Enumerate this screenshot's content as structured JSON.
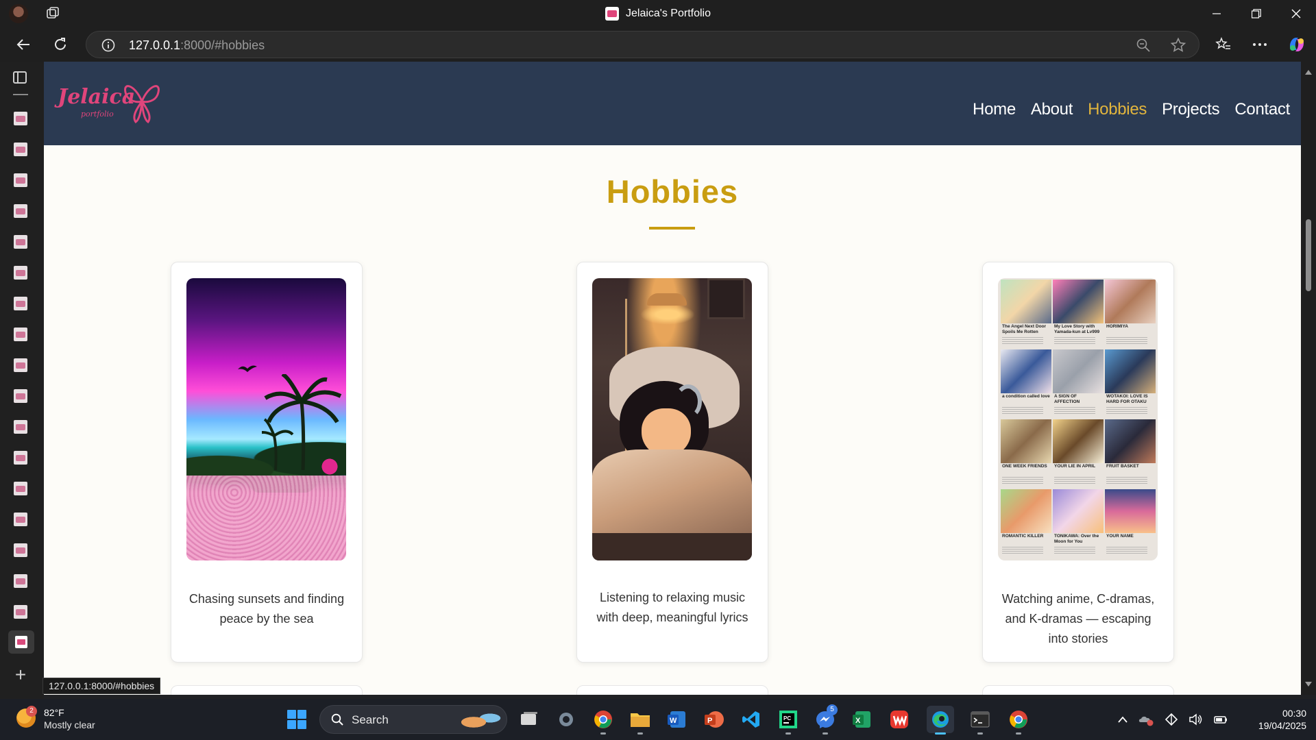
{
  "window": {
    "title": "Jelaica's Portfolio"
  },
  "address_bar": {
    "url_host": "127.0.0.1",
    "url_rest": ":8000/#hobbies"
  },
  "site": {
    "logo_text": "Jelaica",
    "logo_subtext": "portfolio",
    "nav": [
      "Home",
      "About",
      "Hobbies",
      "Projects",
      "Contact"
    ],
    "active_nav": "Hobbies",
    "section_title": "Hobbies",
    "hobbies": [
      {
        "image": "sunset-beach",
        "caption": "Chasing sunsets and finding peace by the sea"
      },
      {
        "image": "anime-girl-headphones",
        "caption": "Listening to relaxing music with deep, meaningful lyrics"
      },
      {
        "image": "anime-collage",
        "caption": "Watching anime, C-dramas, and K-dramas — escaping into stories"
      }
    ],
    "anime_titles": [
      "The Angel Next Door Spoils Me Rotten",
      "My Love Story with Yamada-kun at Lv999",
      "HORIMIYA",
      "a condition called love",
      "A SIGN OF AFFECTION",
      "WOTAKOI: LOVE IS HARD FOR OTAKU",
      "ONE WEEK FRIENDS",
      "YOUR LIE IN APRIL",
      "FRUIT BASKET",
      "ROMANTIC KILLER",
      "TONIKAWA: Over the Moon for You",
      "YOUR NAME"
    ]
  },
  "status_bar": {
    "hover_url": "127.0.0.1:8000/#hobbies"
  },
  "taskbar": {
    "weather_temp": "82°F",
    "weather_condition": "Mostly clear",
    "weather_badge": "2",
    "search_placeholder": "Search",
    "messenger_badge": "5",
    "time": "00:30",
    "date": "19/04/2025",
    "apps": [
      "task-view",
      "settings",
      "chrome",
      "file-explorer",
      "word",
      "powerpoint",
      "vscode",
      "pycharm",
      "messenger",
      "excel",
      "wps-office",
      "edge",
      "terminal",
      "chrome-profile"
    ]
  },
  "colors": {
    "site_header": "#2b3a52",
    "accent_gold": "#c99d11",
    "nav_active": "#e2b53d",
    "logo_pink": "#e0457b",
    "page_bg": "#fdfcf8"
  }
}
